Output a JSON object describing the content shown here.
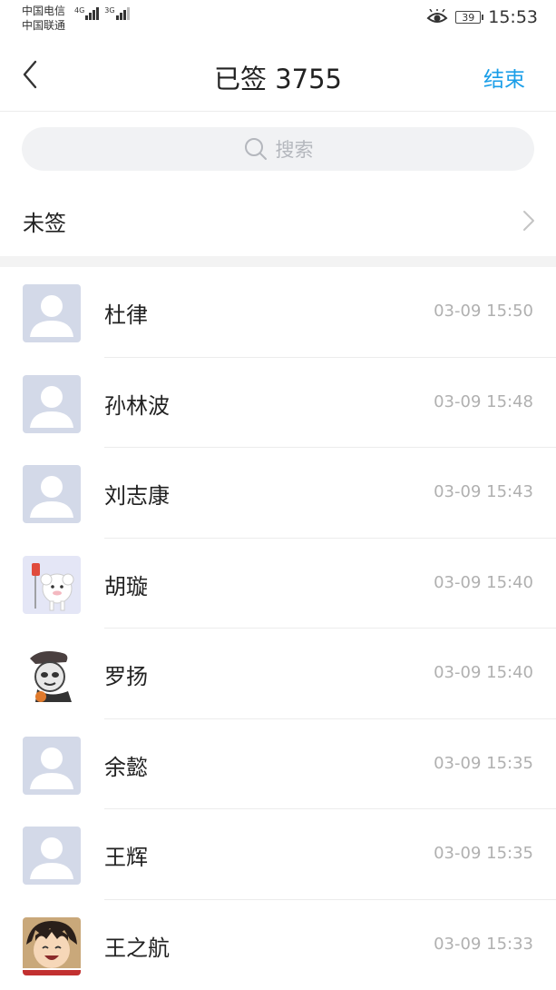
{
  "status_bar": {
    "carrier_1": "中国电信",
    "carrier_2": "中国联通",
    "net_1": "4G",
    "net_2": "3G",
    "battery": "39",
    "time": "15:53"
  },
  "header": {
    "title": "已签 3755",
    "end_label": "结束"
  },
  "search": {
    "placeholder": "搜索"
  },
  "unsigned": {
    "label": "未签"
  },
  "members": [
    {
      "name": "杜律",
      "time": "03-09 15:50",
      "avatar": "default-avatar"
    },
    {
      "name": "孙林波",
      "time": "03-09 15:48",
      "avatar": "default-avatar"
    },
    {
      "name": "刘志康",
      "time": "03-09 15:43",
      "avatar": "default-avatar"
    },
    {
      "name": "胡璇",
      "time": "03-09 15:40",
      "avatar": "sheep-avatar"
    },
    {
      "name": "罗扬",
      "time": "03-09 15:40",
      "avatar": "panda-meme-avatar"
    },
    {
      "name": "余懿",
      "time": "03-09 15:35",
      "avatar": "default-avatar"
    },
    {
      "name": "王辉",
      "time": "03-09 15:35",
      "avatar": "default-avatar"
    },
    {
      "name": "王之航",
      "time": "03-09 15:33",
      "avatar": "anime-boy-avatar"
    }
  ],
  "colors": {
    "accent": "#1a9ee8",
    "avatar_bg": "#d3d9e8",
    "time_text": "#b0b0b0"
  }
}
